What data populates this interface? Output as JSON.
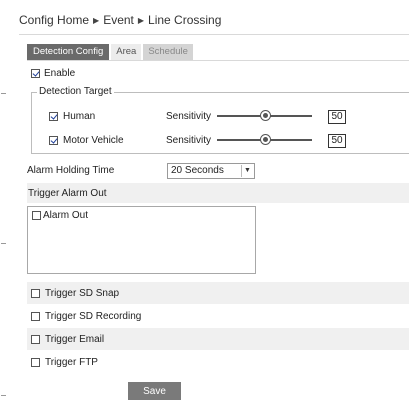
{
  "breadcrumb": {
    "items": [
      "Config Home",
      "Event",
      "Line Crossing"
    ],
    "separator": "▶"
  },
  "tabs": [
    {
      "label": "Detection Config",
      "state": "active"
    },
    {
      "label": "Area",
      "state": "inactive"
    },
    {
      "label": "Schedule",
      "state": "disabled"
    }
  ],
  "enable": {
    "label": "Enable",
    "checked": true
  },
  "detection_target": {
    "legend": "Detection Target",
    "items": [
      {
        "label": "Human",
        "checked": true,
        "sensitivity_label": "Sensitivity",
        "value": "50",
        "level": 0.5
      },
      {
        "label": "Motor Vehicle",
        "checked": true,
        "sensitivity_label": "Sensitivity",
        "value": "50",
        "level": 0.5
      }
    ]
  },
  "alarm_holding_time": {
    "label": "Alarm Holding Time",
    "value": "20 Seconds"
  },
  "trigger_alarm_out": {
    "label": "Trigger Alarm Out",
    "option_label": "Alarm Out",
    "checked": false
  },
  "triggers": [
    {
      "label": "Trigger SD Snap",
      "checked": false
    },
    {
      "label": "Trigger SD Recording",
      "checked": false
    },
    {
      "label": "Trigger Email",
      "checked": false
    },
    {
      "label": "Trigger FTP",
      "checked": false
    }
  ],
  "save_label": "Save"
}
